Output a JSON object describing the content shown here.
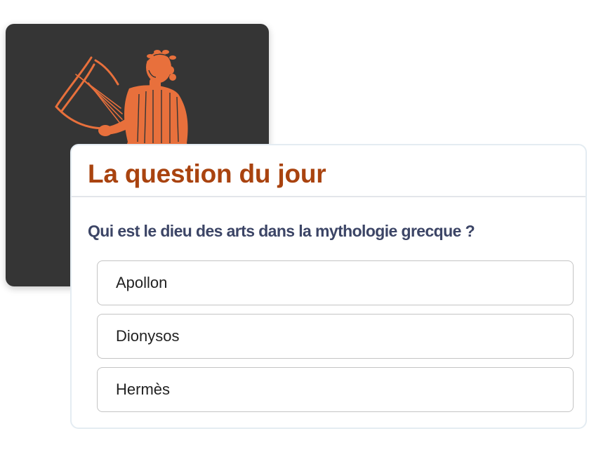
{
  "quiz": {
    "title": "La question du jour",
    "question": "Qui est le dieu des arts dans la mythologie grecque ?",
    "options": [
      "Apollon",
      "Dionysos",
      "Hermès"
    ]
  },
  "image": {
    "subject": "apollo-with-lyre-icon"
  },
  "colors": {
    "title": "#a9430f",
    "question": "#3c4566",
    "illustration": "#e8703c",
    "art_background": "#353535"
  }
}
